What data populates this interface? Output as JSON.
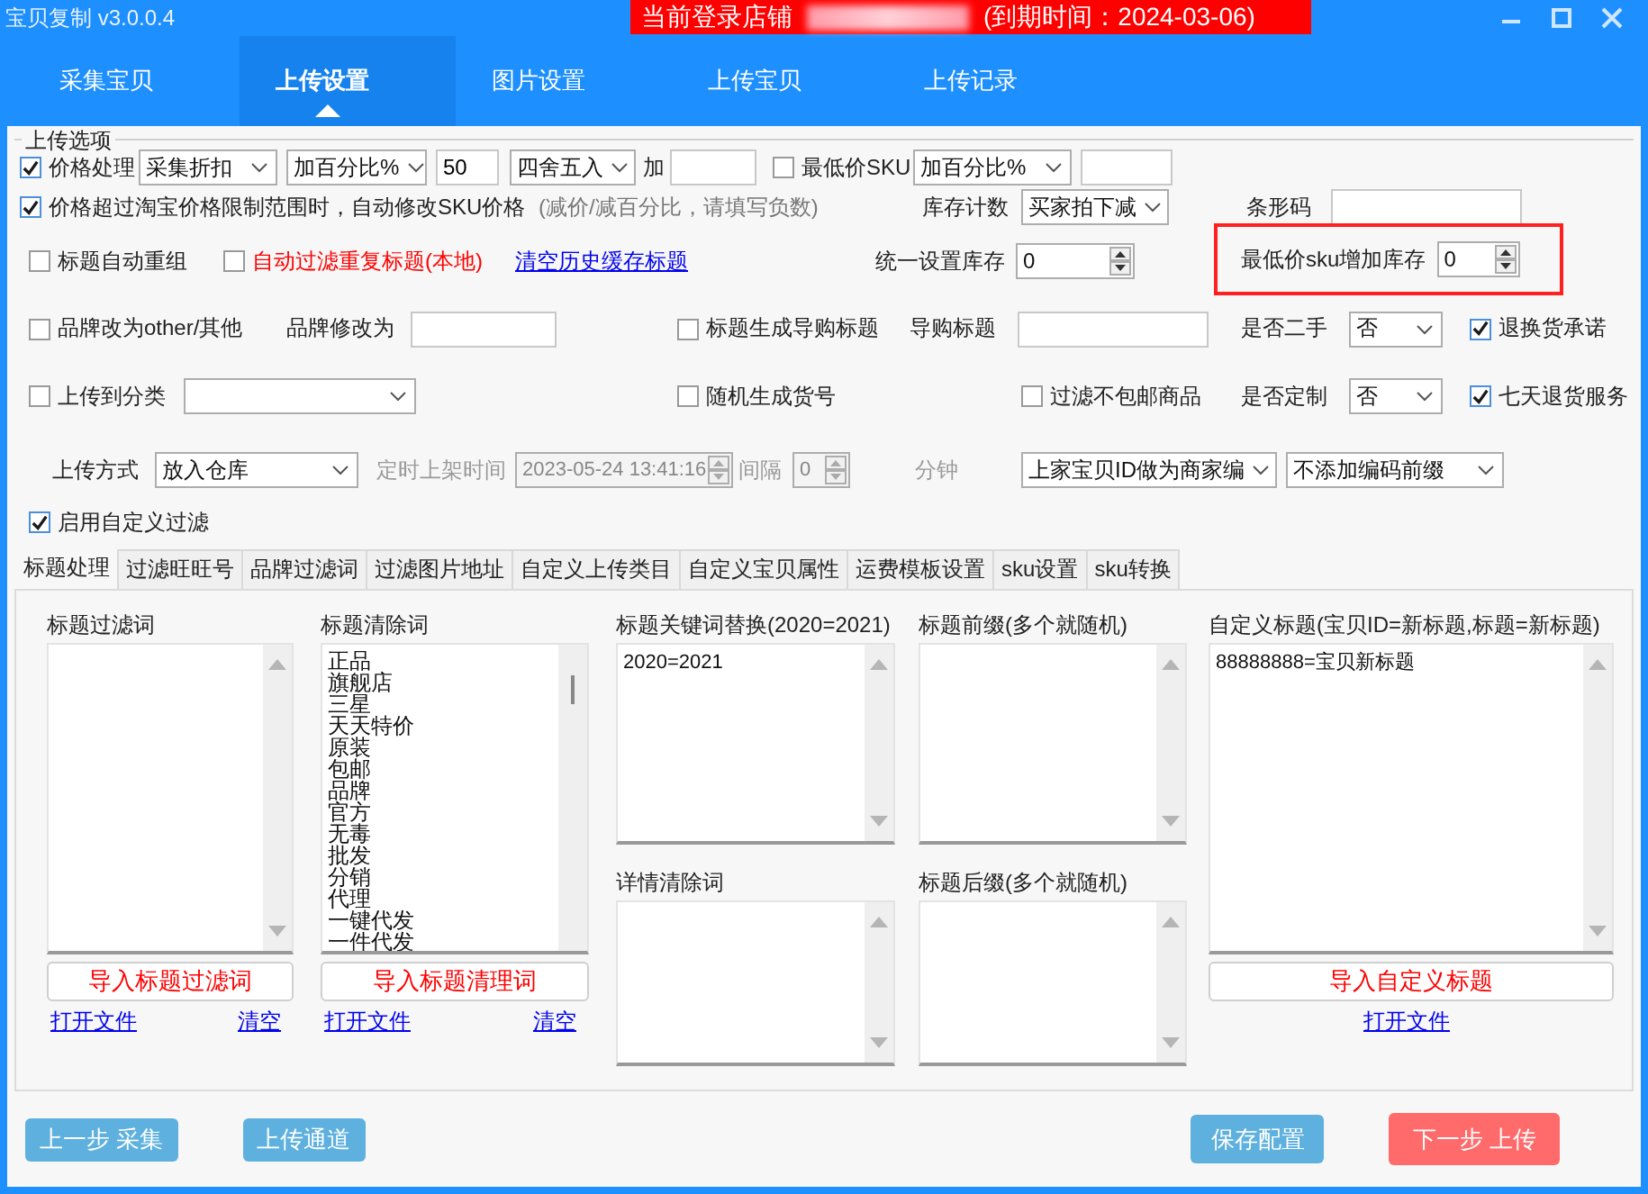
{
  "window": {
    "title": "宝贝复制 v3.0.0.4",
    "store_label": "当前登录店铺",
    "expiry": "(到期时间：2024-03-06)"
  },
  "nav_tabs": [
    {
      "label": "采集宝贝",
      "selected": false
    },
    {
      "label": "上传设置",
      "selected": true
    },
    {
      "label": "图片设置",
      "selected": false
    },
    {
      "label": "上传宝贝",
      "selected": false
    },
    {
      "label": "上传记录",
      "selected": false
    }
  ],
  "upload_options": {
    "title": "上传选项",
    "rows": [
      {
        "items": [
          {
            "kind": "checkbox",
            "text": "价格处理",
            "checked": true,
            "alert": false
          },
          {
            "kind": "select",
            "value": "采集折扣"
          },
          {
            "kind": "select",
            "value": "加百分比%"
          },
          {
            "kind": "input",
            "value": "50"
          },
          {
            "kind": "select",
            "value": "四舍五入"
          },
          {
            "kind": "label",
            "text": "加"
          },
          {
            "kind": "input"
          },
          {
            "kind": "checkbox",
            "text": "最低价SKU",
            "checked": false,
            "alert": false
          },
          {
            "kind": "select",
            "value": "加百分比%"
          },
          {
            "kind": "input"
          }
        ]
      },
      {
        "items": [
          {
            "kind": "checkbox",
            "text": "价格超过淘宝价格限制范围时，自动修改SKU价格",
            "checked": true,
            "alert": false
          },
          {
            "kind": "note",
            "text": "(减价/减百分比，请填写负数)"
          },
          {
            "kind": "label",
            "text": "库存计数"
          },
          {
            "kind": "select",
            "value": "买家拍下减"
          },
          {
            "kind": "label",
            "text": "条形码"
          },
          {
            "kind": "input"
          }
        ]
      },
      {
        "items": [
          {
            "kind": "checkbox",
            "text": "标题自动重组",
            "checked": false,
            "alert": false
          },
          {
            "kind": "checkbox",
            "text": "自动过滤重复标题(本地)",
            "checked": false,
            "alert": true
          },
          {
            "kind": "link",
            "text": "清空历史缓存标题"
          },
          {
            "kind": "spinner",
            "label": "统一设置库存",
            "value": "0",
            "highlighted": false
          },
          {
            "kind": "spinner",
            "label": "最低价sku增加库存",
            "value": "0",
            "highlighted": true
          }
        ]
      },
      {
        "items": [
          {
            "kind": "checkbox",
            "text": "品牌改为other/其他",
            "checked": false,
            "alert": false
          },
          {
            "kind": "label",
            "text": "品牌修改为"
          },
          {
            "kind": "input"
          },
          {
            "kind": "checkbox",
            "text": "标题生成导购标题",
            "checked": false,
            "alert": false
          },
          {
            "kind": "label",
            "text": "导购标题"
          },
          {
            "kind": "input"
          },
          {
            "kind": "label",
            "text": "是否二手"
          },
          {
            "kind": "select",
            "value": "否"
          },
          {
            "kind": "checkbox",
            "text": "退换货承诺",
            "checked": true,
            "alert": false
          }
        ]
      },
      {
        "items": [
          {
            "kind": "checkbox",
            "text": "上传到分类",
            "checked": false,
            "alert": false
          },
          {
            "kind": "select"
          },
          {
            "kind": "checkbox",
            "text": "随机生成货号",
            "checked": false,
            "alert": false
          },
          {
            "kind": "checkbox",
            "text": "过滤不包邮商品",
            "checked": false,
            "alert": false
          },
          {
            "kind": "label",
            "text": "是否定制"
          },
          {
            "kind": "select",
            "value": "否"
          },
          {
            "kind": "checkbox",
            "text": "七天退货服务",
            "checked": true,
            "alert": false
          }
        ]
      },
      {
        "items": [
          {
            "kind": "label",
            "text": "上传方式",
            "disabled": false
          },
          {
            "kind": "select",
            "value": "放入仓库"
          },
          {
            "kind": "label",
            "text": "定时上架时间",
            "disabled": true
          },
          {
            "kind": "spinner",
            "value": "2023-05-24 13:41:16",
            "disabled": true
          },
          {
            "kind": "spinner",
            "label": "间隔",
            "value": "0",
            "disabled": true
          },
          {
            "kind": "label",
            "text": "分钟",
            "disabled": true
          },
          {
            "kind": "select",
            "value": "上家宝贝ID做为商家编"
          },
          {
            "kind": "select",
            "value": "不添加编码前缀"
          }
        ]
      },
      {
        "items": [
          {
            "kind": "checkbox",
            "text": "启用自定义过滤",
            "checked": true,
            "alert": false
          }
        ]
      }
    ]
  },
  "sub_tabs": [
    {
      "label": "标题处理",
      "selected": true
    },
    {
      "label": "过滤旺旺号",
      "selected": false
    },
    {
      "label": "品牌过滤词",
      "selected": false
    },
    {
      "label": "过滤图片地址",
      "selected": false
    },
    {
      "label": "自定义上传类目",
      "selected": false
    },
    {
      "label": "自定义宝贝属性",
      "selected": false
    },
    {
      "label": "运费模板设置",
      "selected": false
    },
    {
      "label": "sku设置",
      "selected": false
    },
    {
      "label": "sku转换",
      "selected": false
    }
  ],
  "title_tab": {
    "columns": [
      {
        "fields": [
          {
            "label": "标题过滤词"
          }
        ],
        "import_button": "导入标题过滤词",
        "links": [
          "打开文件",
          "清空"
        ]
      },
      {
        "fields": [
          {
            "label": "标题清除词",
            "lines": [
              "正品",
              "旗舰店",
              "三星",
              "天天特价",
              "原装",
              "包邮",
              "品牌",
              "官方",
              "无毒",
              "批发",
              "分销",
              "代理",
              "一键代发",
              "一件代发"
            ]
          }
        ],
        "import_button": "导入标题清理词",
        "links": [
          "打开文件",
          "清空"
        ]
      },
      {
        "fields": [
          {
            "label": "标题关键词替换(2020=2021)",
            "lines": [
              "2020=2021"
            ]
          },
          {
            "label": "详情清除词"
          }
        ]
      },
      {
        "fields": [
          {
            "label": "标题前缀(多个就随机)"
          },
          {
            "label": "标题后缀(多个就随机)"
          }
        ]
      },
      {
        "fields": [
          {
            "label": "自定义标题(宝贝ID=新标题,标题=新标题)",
            "lines": [
              "88888888=宝贝新标题"
            ]
          }
        ],
        "import_button": "导入自定义标题",
        "links": [
          "打开文件"
        ]
      }
    ]
  },
  "footer_buttons": [
    {
      "label": "上一步 采集",
      "kind": "secondary"
    },
    {
      "label": "上传通道",
      "kind": "secondary"
    },
    {
      "label": "保存配置",
      "kind": "primary"
    },
    {
      "label": "下一步 上传",
      "kind": "danger"
    }
  ]
}
